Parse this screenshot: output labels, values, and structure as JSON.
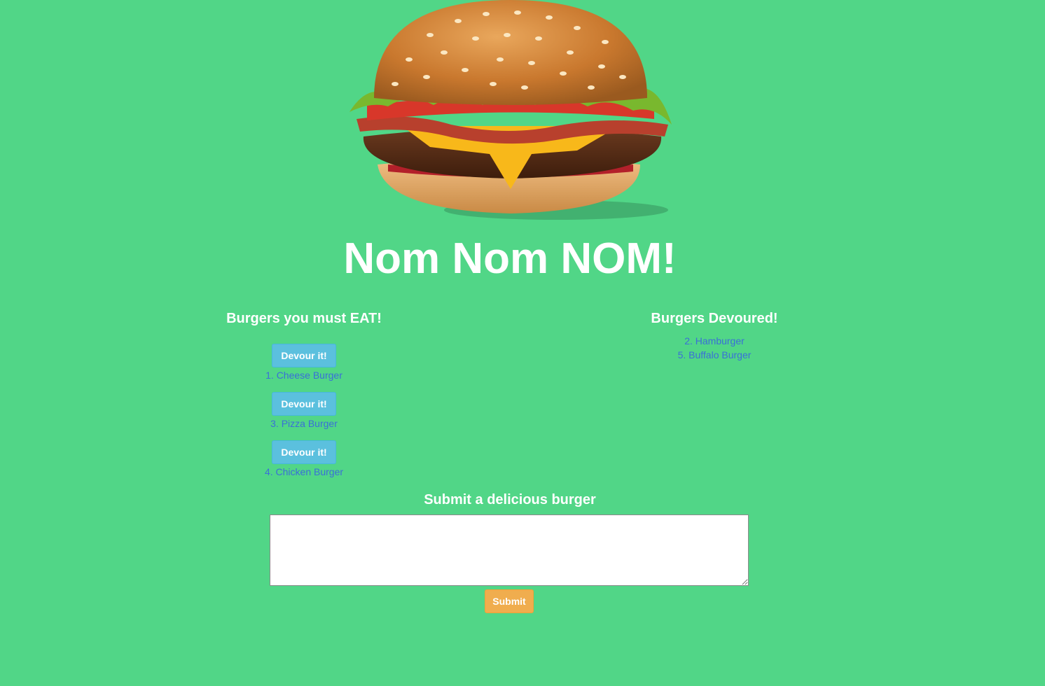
{
  "page": {
    "background_color": "#51d687",
    "title": "Nom Nom NOM!"
  },
  "hero_image": {
    "icon": "burger-image"
  },
  "eat_section": {
    "heading": "Burgers you must EAT!",
    "button_label": "Devour it!",
    "items": [
      {
        "label": "1. Cheese Burger"
      },
      {
        "label": "3. Pizza Burger"
      },
      {
        "label": "4. Chicken Burger"
      }
    ]
  },
  "devoured_section": {
    "heading": "Burgers Devoured!",
    "items": [
      {
        "label": "2. Hamburger"
      },
      {
        "label": "5. Buffalo Burger"
      }
    ]
  },
  "submit_section": {
    "heading": "Submit a delicious burger",
    "textarea_value": "",
    "button_label": "Submit"
  },
  "colors": {
    "info_button": "#5bc0de",
    "warning_button": "#f0ad4e",
    "link_text": "#3a6fd8"
  }
}
